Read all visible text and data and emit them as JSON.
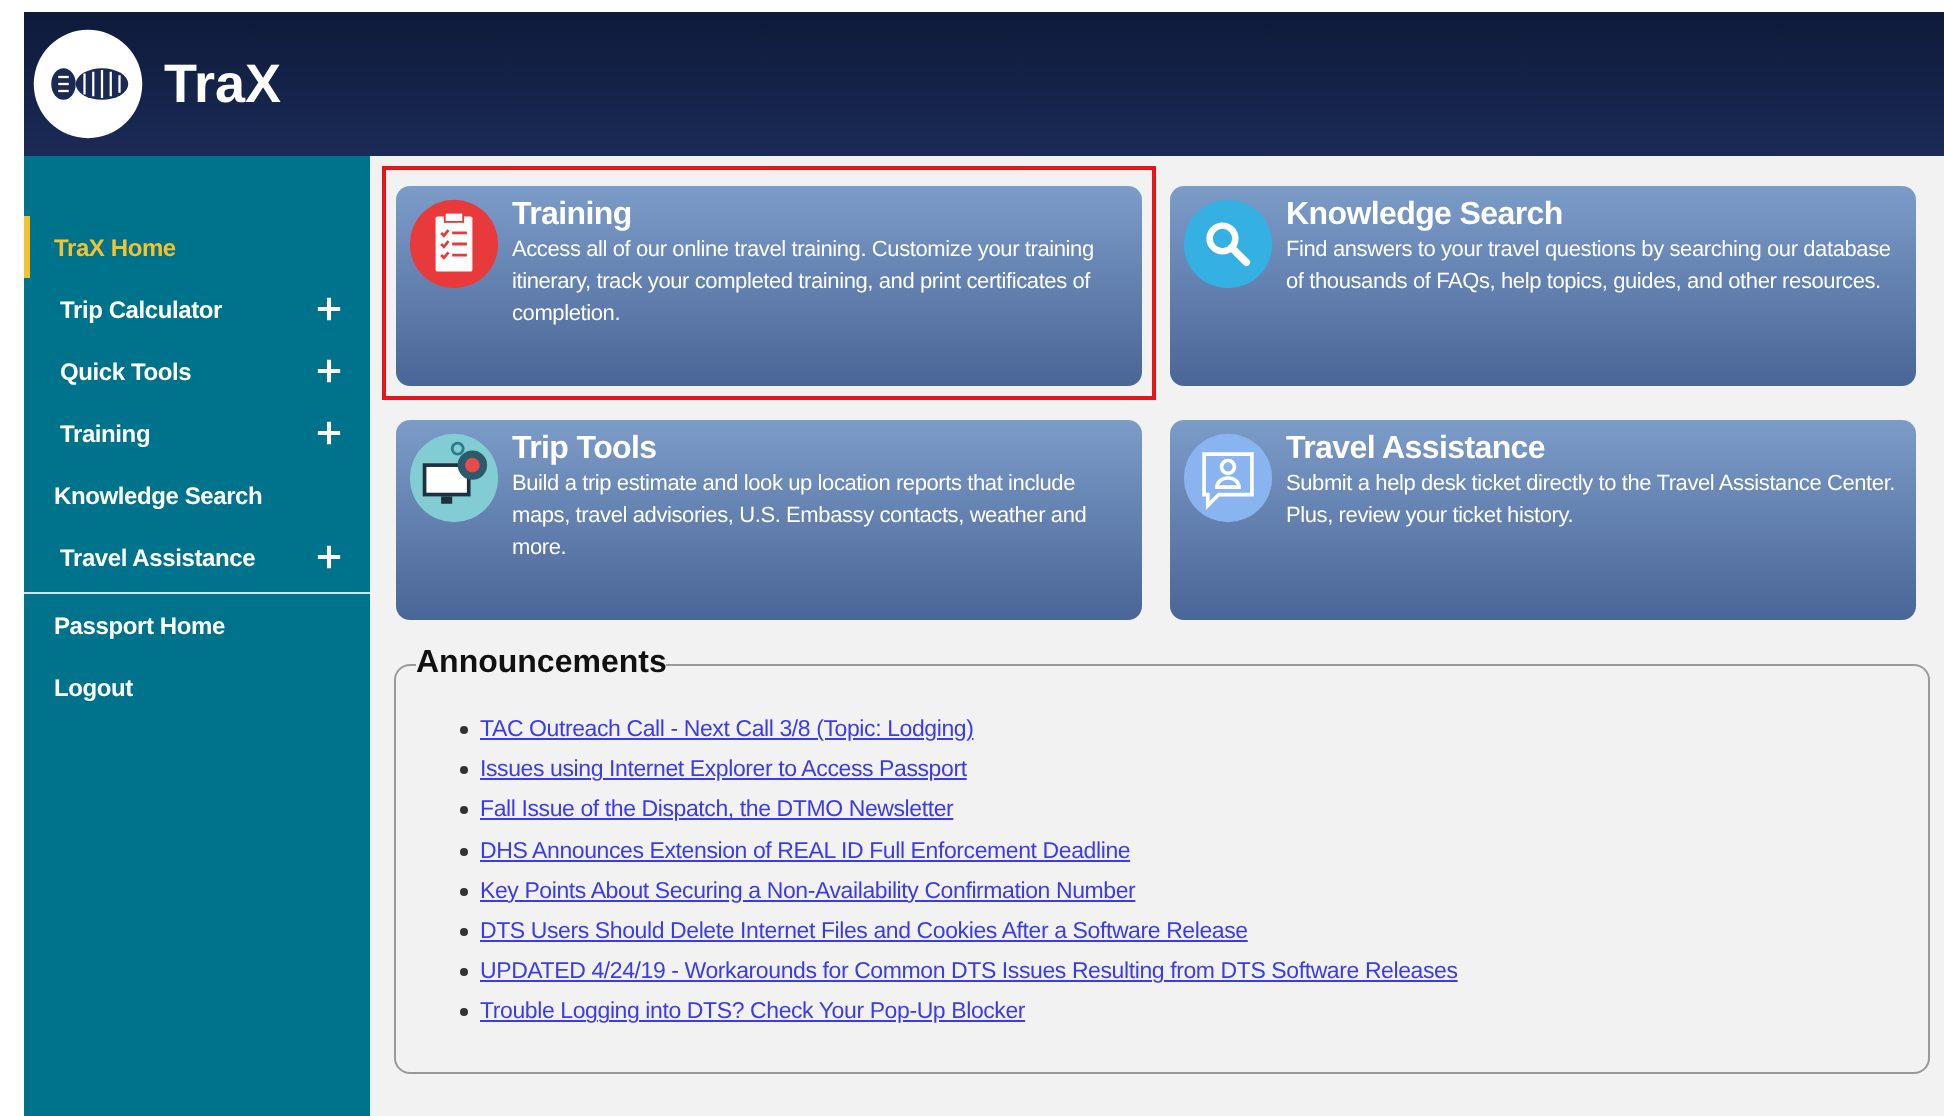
{
  "header": {
    "title": "TraX"
  },
  "sidebar": {
    "items": [
      {
        "label": "TraX Home",
        "selected": true,
        "expandable": false,
        "indented": false
      },
      {
        "label": "Trip Calculator",
        "selected": false,
        "expandable": true,
        "indented": true
      },
      {
        "label": "Quick Tools",
        "selected": false,
        "expandable": true,
        "indented": true
      },
      {
        "label": "Training",
        "selected": false,
        "expandable": true,
        "indented": true
      },
      {
        "label": "Knowledge Search",
        "selected": false,
        "expandable": false,
        "indented": false
      },
      {
        "label": "Travel Assistance",
        "selected": false,
        "expandable": true,
        "indented": true
      }
    ],
    "footer_items": [
      {
        "label": "Passport Home"
      },
      {
        "label": "Logout"
      }
    ]
  },
  "cards": [
    {
      "kind": "clipboard",
      "color": "#e83a3a",
      "title": "Training",
      "description": "Access all of our online travel training. Customize your training itinerary, track your completed training, and print certificates of completion.",
      "highlighted": true
    },
    {
      "kind": "search",
      "color": "#35b0e3",
      "title": "Knowledge Search",
      "description": "Find answers to your travel questions by searching our database of thousands of FAQs, help topics, guides, and other resources.",
      "highlighted": false
    },
    {
      "kind": "monitor",
      "color": "#82ccd3",
      "title": "Trip Tools",
      "description": "Build a trip estimate and look up location reports that include maps, travel advisories, U.S. Embassy contacts, weather and more.",
      "highlighted": false
    },
    {
      "kind": "chat",
      "color": "#8ab4ef",
      "title": "Travel Assistance",
      "description": "Submit a help desk ticket directly to the Travel Assistance Center. Plus, review your ticket history.",
      "highlighted": false
    }
  ],
  "announcements": {
    "title": "Announcements",
    "items": [
      "TAC Outreach Call - Next Call 3/8 (Topic: Lodging)",
      "Issues using Internet Explorer to Access Passport",
      "Fall Issue of the Dispatch, the DTMO Newsletter",
      "DHS Announces Extension of REAL ID Full Enforcement Deadline",
      "Key Points About Securing a Non-Availability Confirmation Number",
      "DTS Users Should Delete Internet Files and Cookies After a Software Release",
      "UPDATED 4/24/19 - Workarounds for Common DTS Issues Resulting from DTS Software Releases",
      "Trouble Logging into DTS? Check Your Pop-Up Blocker"
    ]
  }
}
